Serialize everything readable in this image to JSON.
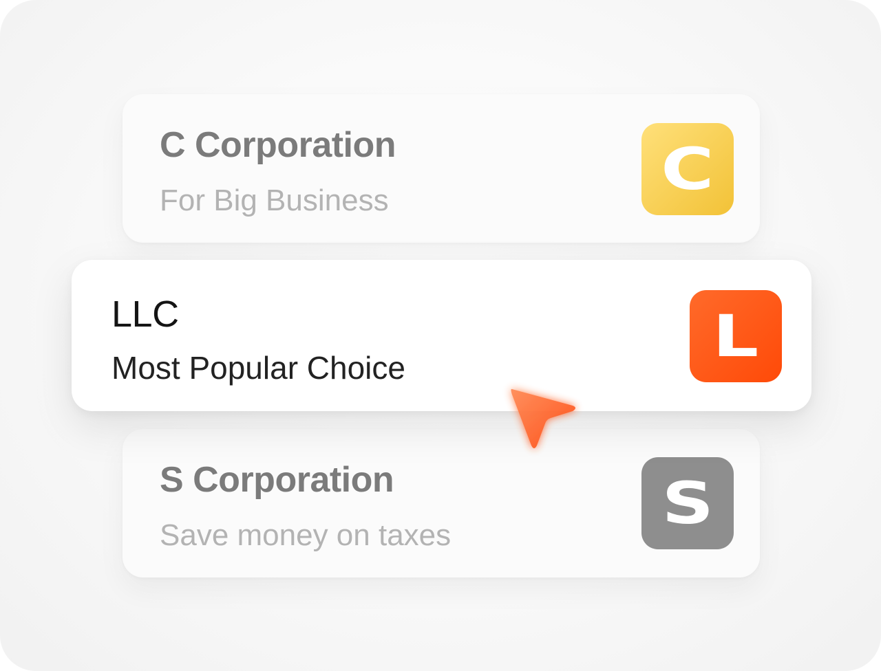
{
  "options": [
    {
      "title": "C Corporation",
      "subtitle": "For Big Business",
      "badge_letter": "C",
      "badge_color": "#f4c53a"
    },
    {
      "title": "LLC",
      "subtitle": "Most Popular Choice",
      "badge_letter": "L",
      "badge_color": "#ff5412",
      "selected": true
    },
    {
      "title": "S Corporation",
      "subtitle": "Save money on taxes",
      "badge_letter": "S",
      "badge_color": "#8e8e8e"
    }
  ],
  "cursor": {
    "icon": "pointer-arrow-icon",
    "color": "#ff5a1f"
  }
}
